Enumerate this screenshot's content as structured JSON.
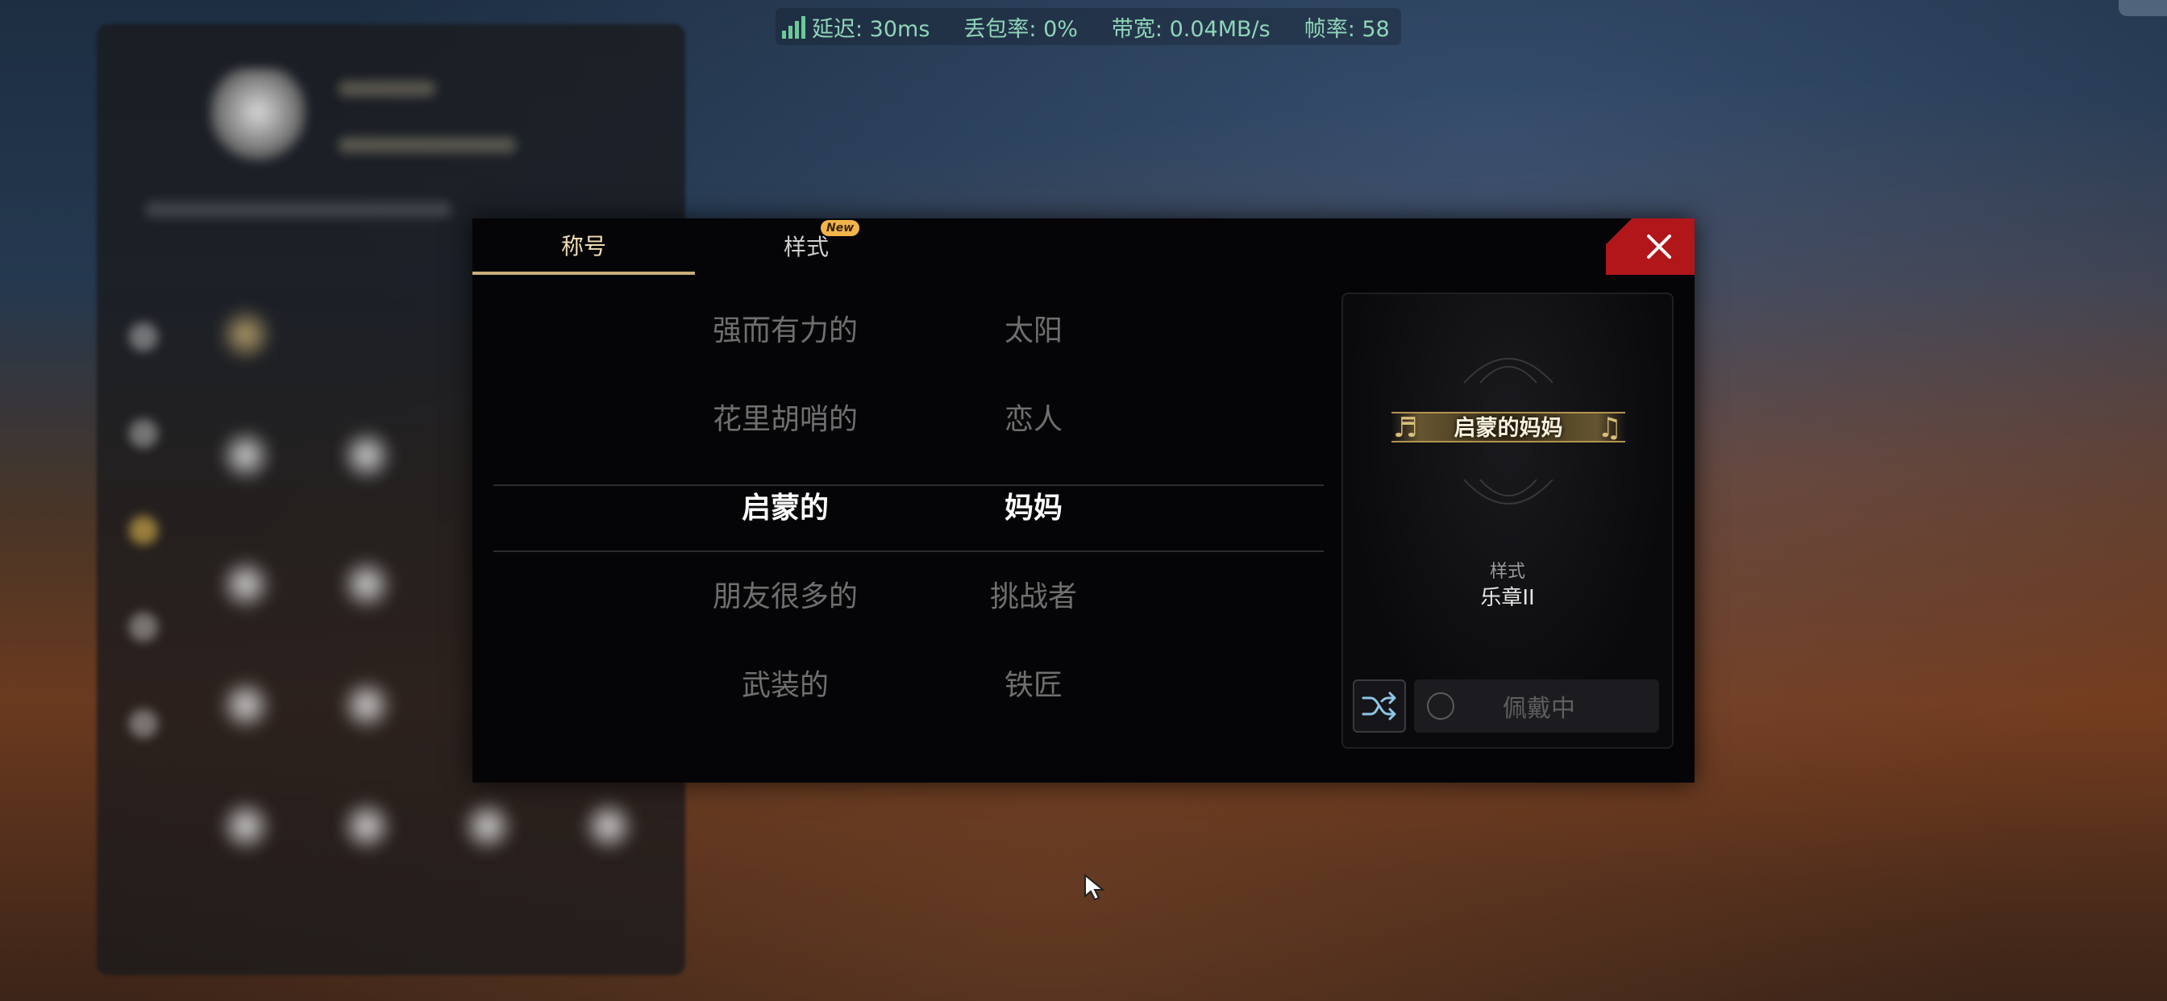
{
  "status": {
    "latency": "延迟: 30ms",
    "packet_loss": "丢包率: 0%",
    "bandwidth": "带宽: 0.04MB/s",
    "fps": "帧率: 58"
  },
  "tabs": [
    {
      "label": "称号",
      "active": true
    },
    {
      "label": "样式",
      "active": false,
      "badge": "New"
    }
  ],
  "picker": {
    "adjectives": [
      "强而有力的",
      "花里胡哨的",
      "启蒙的",
      "朋友很多的",
      "武装的"
    ],
    "nouns": [
      "太阳",
      "恋人",
      "妈妈",
      "挑战者",
      "铁匠"
    ],
    "selected_index": 2
  },
  "preview": {
    "title": "启蒙的妈妈",
    "style_caption": "样式",
    "style_value": "乐章II"
  },
  "actions": {
    "wear_label": "佩戴中"
  },
  "colors": {
    "accent_gold": "#c9ae7a",
    "close_red": "#b1161a",
    "status_green": "#8fd6b8",
    "badge_orange": "#f1b54a"
  },
  "icons": [
    "signal-icon",
    "close-icon",
    "shuffle-icon",
    "radio-icon",
    "cursor-icon"
  ]
}
